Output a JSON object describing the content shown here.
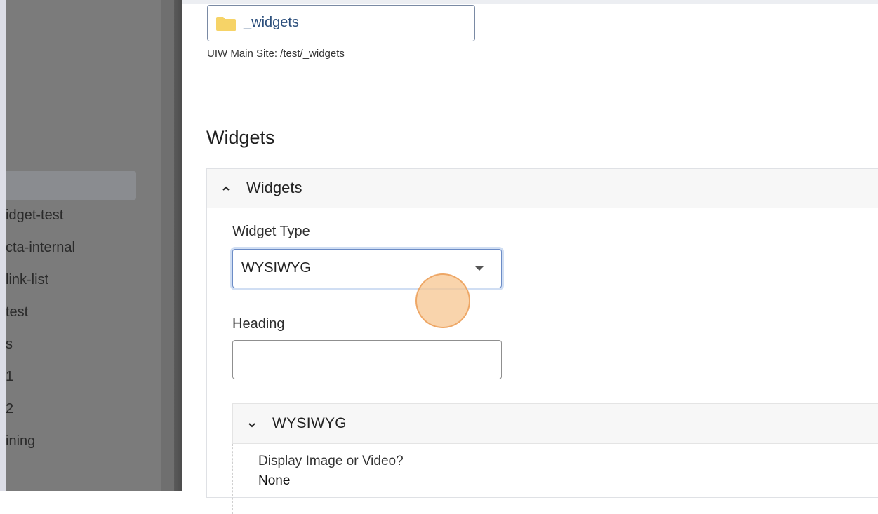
{
  "sidebar": {
    "items": [
      {
        "label": "idget-test"
      },
      {
        "label": "cta-internal"
      },
      {
        "label": "link-list"
      },
      {
        "label": "test"
      },
      {
        "label": "s"
      },
      {
        "label": "1"
      },
      {
        "label": "2"
      },
      {
        "label": "ining"
      }
    ]
  },
  "folder": {
    "name": "_widgets",
    "icon": "folder-icon",
    "icon_color": "#f6d367",
    "path": "UIW Main Site: /test/_widgets"
  },
  "section": {
    "title": "Widgets"
  },
  "widgets_panel": {
    "title": "Widgets",
    "widget_type_label": "Widget Type",
    "widget_type_value": "WYSIWYG",
    "heading_label": "Heading",
    "heading_value": "",
    "sub_panel": {
      "title": "WYSIWYG",
      "display_label": "Display Image or Video?",
      "display_value": "None"
    }
  },
  "colors": {
    "accent_focus": "#6c8cc6",
    "click_marker": "#f7c48c",
    "sidebar_overlay": "#7b7b7b"
  }
}
